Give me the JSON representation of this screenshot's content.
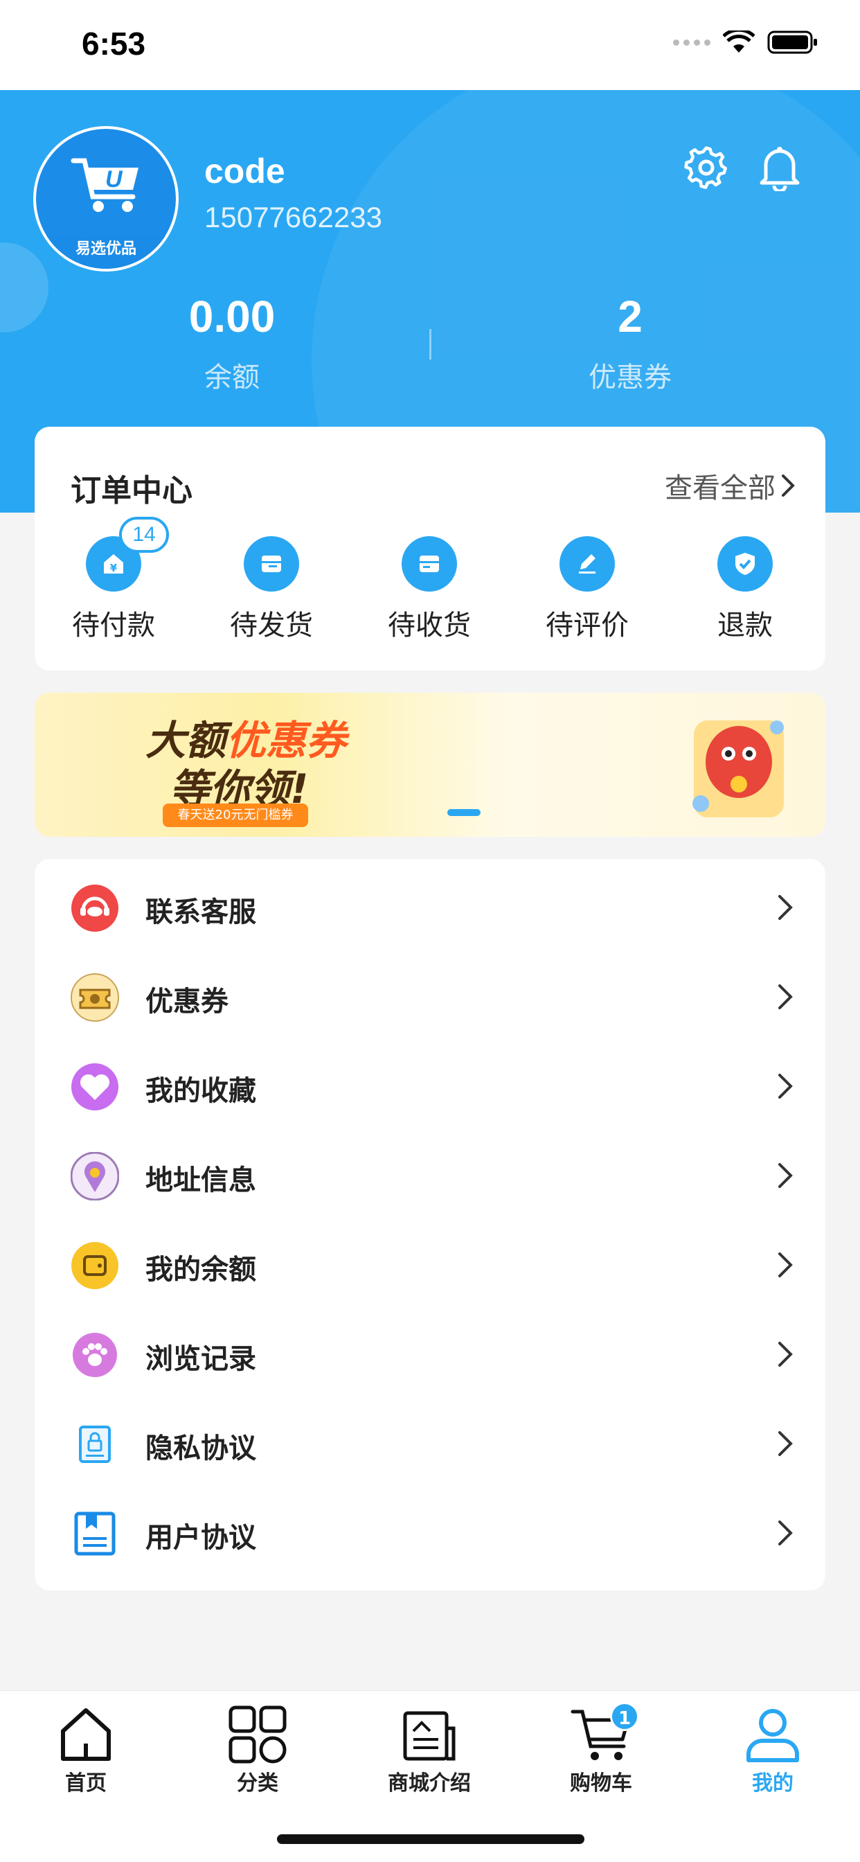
{
  "status_bar": {
    "time": "6:53"
  },
  "profile": {
    "avatar_text": "易选优品",
    "name": "code",
    "phone": "15077662233"
  },
  "stats": {
    "balance_value": "0.00",
    "balance_label": "余额",
    "coupon_value": "2",
    "coupon_label": "优惠券"
  },
  "orders": {
    "title": "订单中心",
    "view_all": "查看全部",
    "items": [
      {
        "label": "待付款",
        "badge": "14",
        "icon": "wallet-icon"
      },
      {
        "label": "待发货",
        "icon": "box-icon"
      },
      {
        "label": "待收货",
        "icon": "truck-icon"
      },
      {
        "label": "待评价",
        "icon": "pen-icon"
      },
      {
        "label": "退款",
        "icon": "shield-icon"
      }
    ]
  },
  "banner": {
    "line1_a": "大额",
    "line1_b": "优惠券",
    "line2": "等你领!",
    "sub": "春天送20元无门槛券"
  },
  "menu": {
    "items": [
      {
        "label": "联系客服",
        "icon": "customer-service-icon",
        "color": "#f04747"
      },
      {
        "label": "优惠券",
        "icon": "coupon-icon",
        "color": "#f2c24a"
      },
      {
        "label": "我的收藏",
        "icon": "heart-icon",
        "color": "#c86cf0"
      },
      {
        "label": "地址信息",
        "icon": "location-icon",
        "color": "#b27ad8"
      },
      {
        "label": "我的余额",
        "icon": "wallet-icon",
        "color": "#f8c427"
      },
      {
        "label": "浏览记录",
        "icon": "footprint-icon",
        "color": "#d77ae0"
      },
      {
        "label": "隐私协议",
        "icon": "privacy-icon",
        "color": "#2aa7f2"
      },
      {
        "label": "用户协议",
        "icon": "agreement-icon",
        "color": "#1a8be6"
      }
    ]
  },
  "tabbar": {
    "items": [
      {
        "label": "首页",
        "icon": "home-icon"
      },
      {
        "label": "分类",
        "icon": "category-icon"
      },
      {
        "label": "商城介绍",
        "icon": "mall-intro-icon"
      },
      {
        "label": "购物车",
        "icon": "cart-icon",
        "badge": "1"
      },
      {
        "label": "我的",
        "icon": "user-icon",
        "active": true
      }
    ]
  },
  "colors": {
    "primary": "#2aa7f2",
    "background": "#f4f4f4"
  }
}
